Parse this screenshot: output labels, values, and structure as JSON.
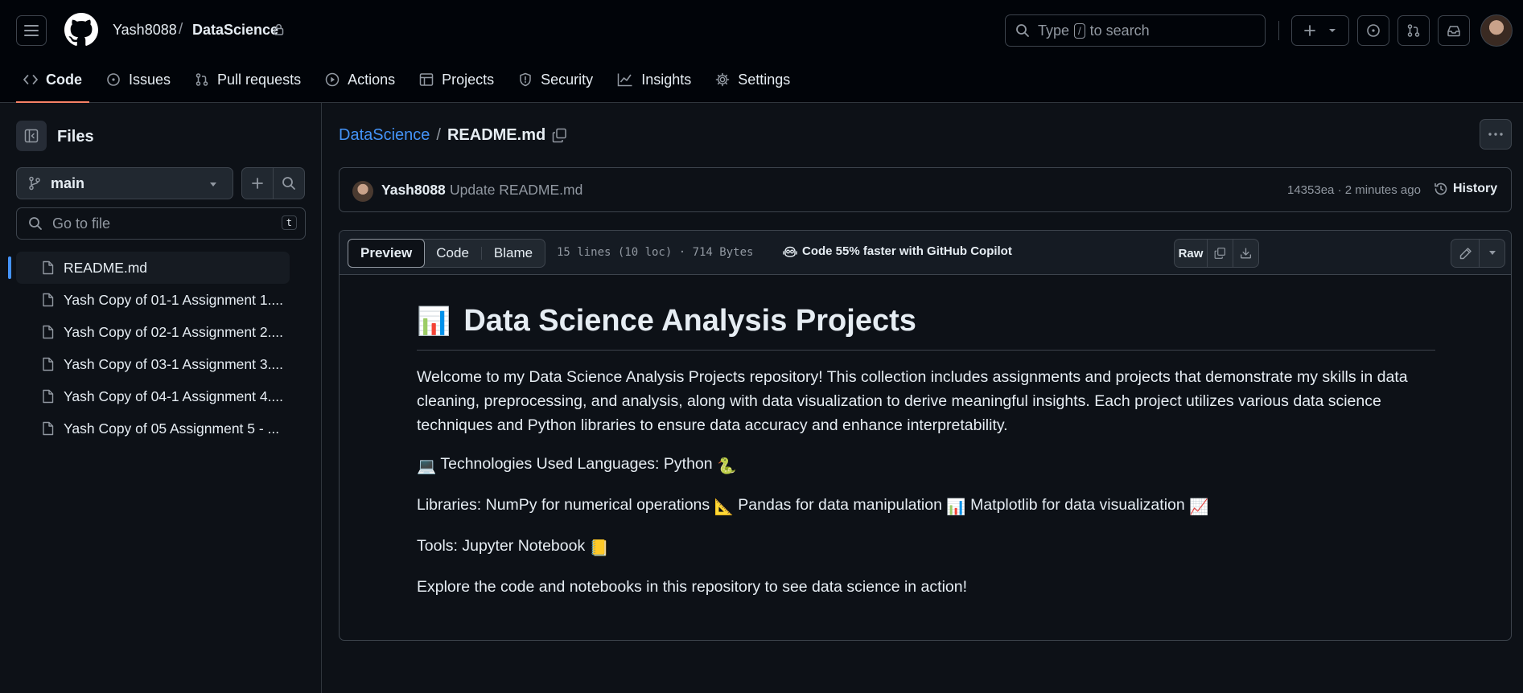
{
  "header": {
    "owner": "Yash8088",
    "separator": "/",
    "repo": "DataScience",
    "search_prefix": "Type",
    "search_key": "/",
    "search_suffix": "to search"
  },
  "repo_tabs": [
    {
      "label": "Code",
      "icon": "code-icon"
    },
    {
      "label": "Issues",
      "icon": "issue-icon"
    },
    {
      "label": "Pull requests",
      "icon": "pull-request-icon"
    },
    {
      "label": "Actions",
      "icon": "play-icon"
    },
    {
      "label": "Projects",
      "icon": "table-icon"
    },
    {
      "label": "Security",
      "icon": "shield-icon"
    },
    {
      "label": "Insights",
      "icon": "graph-icon"
    },
    {
      "label": "Settings",
      "icon": "gear-icon"
    }
  ],
  "sidebar": {
    "title": "Files",
    "branch": "main",
    "goto_placeholder": "Go to file",
    "goto_key": "t",
    "files": [
      "README.md",
      "Yash Copy of 01-1 Assignment 1....",
      "Yash Copy of 02-1 Assignment 2....",
      "Yash Copy of 03-1 Assignment 3....",
      "Yash Copy of 04-1 Assignment 4....",
      "Yash Copy of 05 Assignment 5 - ..."
    ]
  },
  "path": {
    "repo": "DataScience",
    "separator": "/",
    "file": "README.md"
  },
  "commit": {
    "author": "Yash8088",
    "message": "Update README.md",
    "meta": "14353ea · 2 minutes ago",
    "history": "History"
  },
  "file_header": {
    "views": [
      "Preview",
      "Code",
      "Blame"
    ],
    "meta": "15 lines (10 loc) · 714 Bytes",
    "copilot": "Code 55% faster with GitHub Copilot",
    "raw": "Raw"
  },
  "readme": {
    "h1_emoji": "📊",
    "title": "Data Science Analysis Projects",
    "intro": "Welcome to my Data Science Analysis Projects repository! This collection includes assignments and projects that demonstrate my skills in data cleaning, preprocessing, and analysis, along with data visualization to derive meaningful insights. Each project utilizes various data science techniques and Python libraries to ensure data accuracy and enhance interpretability.",
    "tech_emoji": "💻",
    "tech": "Technologies Used Languages: Python",
    "tech_emoji2": "🐍",
    "libs_1": "Libraries: NumPy for numerical operations",
    "libs_e1": "📐",
    "libs_2": "Pandas for data manipulation",
    "libs_e2": "📊",
    "libs_3": "Matplotlib for data visualization",
    "libs_e3": "📈",
    "tools": "Tools: Jupyter Notebook",
    "tools_emoji": "📒",
    "outro": "Explore the code and notebooks in this repository to see data science in action!"
  },
  "colors": {
    "background": "#0d1117",
    "header": "#010409",
    "link": "#4493f8",
    "active_tab_underline": "#f78166",
    "border": "#3d444d"
  }
}
